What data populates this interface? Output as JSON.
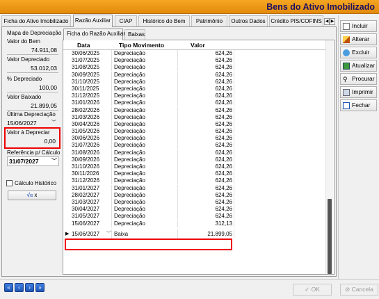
{
  "window": {
    "title": "Bens do Ativo Imobilizado"
  },
  "tabs": [
    "Ficha do Ativo Imobilizado",
    "Razão Auxiliar",
    "CIAP",
    "Histórico do Bem",
    "Patrimônio",
    "Outros Dados",
    "Crédito PIS/COFINS"
  ],
  "active_tab": "Razão Auxiliar",
  "left_panel": {
    "heading": "Mapa de Depreciação",
    "valor_bem_label": "Valor do Bem",
    "valor_bem": "74.911,08",
    "valor_depreciado_label": "Valor Depreciado",
    "valor_depreciado": "53.012,03",
    "pct_depreciado_label": "% Depreciado",
    "pct_depreciado": "100,00",
    "valor_baixado_label": "Valor Baixado",
    "valor_baixado": "21.899,05",
    "ultima_depreciacao_label": "Última Depreciação",
    "ultima_depreciacao": "15/06/2027",
    "valor_a_depreciar_label": "Valor à Depreciar",
    "valor_a_depreciar": "0,00",
    "referencia_label": "Referência p/ Cálculo",
    "referencia": "31/07/2027",
    "calculo_historico_label": "Cálculo Histórico",
    "calc_button_label": "x"
  },
  "subtabs": [
    "Ficha do Razão Auxiliar",
    "Baixas"
  ],
  "grid": {
    "headers": {
      "data": "Data",
      "tipo": "Tipo Movimento",
      "valor": "Valor"
    },
    "rows": [
      {
        "data": "30/06/2025",
        "tipo": "Depreciação",
        "valor": "624,26"
      },
      {
        "data": "31/07/2025",
        "tipo": "Depreciação",
        "valor": "624,26"
      },
      {
        "data": "31/08/2025",
        "tipo": "Depreciação",
        "valor": "624,26"
      },
      {
        "data": "30/09/2025",
        "tipo": "Depreciação",
        "valor": "624,26"
      },
      {
        "data": "31/10/2025",
        "tipo": "Depreciação",
        "valor": "624,26"
      },
      {
        "data": "30/11/2025",
        "tipo": "Depreciação",
        "valor": "624,26"
      },
      {
        "data": "31/12/2025",
        "tipo": "Depreciação",
        "valor": "624,26"
      },
      {
        "data": "31/01/2026",
        "tipo": "Depreciação",
        "valor": "624,26"
      },
      {
        "data": "28/02/2026",
        "tipo": "Depreciação",
        "valor": "624,26"
      },
      {
        "data": "31/03/2026",
        "tipo": "Depreciação",
        "valor": "624,26"
      },
      {
        "data": "30/04/2026",
        "tipo": "Depreciação",
        "valor": "624,26"
      },
      {
        "data": "31/05/2026",
        "tipo": "Depreciação",
        "valor": "624,26"
      },
      {
        "data": "30/06/2026",
        "tipo": "Depreciação",
        "valor": "624,26"
      },
      {
        "data": "31/07/2026",
        "tipo": "Depreciação",
        "valor": "624,26"
      },
      {
        "data": "31/08/2026",
        "tipo": "Depreciação",
        "valor": "624,26"
      },
      {
        "data": "30/09/2026",
        "tipo": "Depreciação",
        "valor": "624,26"
      },
      {
        "data": "31/10/2026",
        "tipo": "Depreciação",
        "valor": "624,26"
      },
      {
        "data": "30/11/2026",
        "tipo": "Depreciação",
        "valor": "624,26"
      },
      {
        "data": "31/12/2026",
        "tipo": "Depreciação",
        "valor": "624,26"
      },
      {
        "data": "31/01/2027",
        "tipo": "Depreciação",
        "valor": "624,26"
      },
      {
        "data": "28/02/2027",
        "tipo": "Depreciação",
        "valor": "624,26"
      },
      {
        "data": "31/03/2027",
        "tipo": "Depreciação",
        "valor": "624,26"
      },
      {
        "data": "30/04/2027",
        "tipo": "Depreciação",
        "valor": "624,26"
      },
      {
        "data": "31/05/2027",
        "tipo": "Depreciação",
        "valor": "624,26"
      },
      {
        "data": "15/06/2027",
        "tipo": "Depreciação",
        "valor": "312,13"
      },
      {
        "data": "15/06/2027",
        "tipo": "Baixa",
        "valor": "21.899,05"
      }
    ]
  },
  "toolbar": {
    "incluir": "Incluir",
    "alterar": "Alterar",
    "excluir": "Excluir",
    "atualizar": "Atualizar",
    "procurar": "Procurar",
    "imprimir": "Imprimir",
    "fechar": "Fechar"
  },
  "footer": {
    "ok": "OK",
    "cancel": "Cancela"
  },
  "colors": {
    "title_bar": "#e38a0a",
    "highlight": "#ee0000",
    "nav_button": "#1f56b8"
  }
}
